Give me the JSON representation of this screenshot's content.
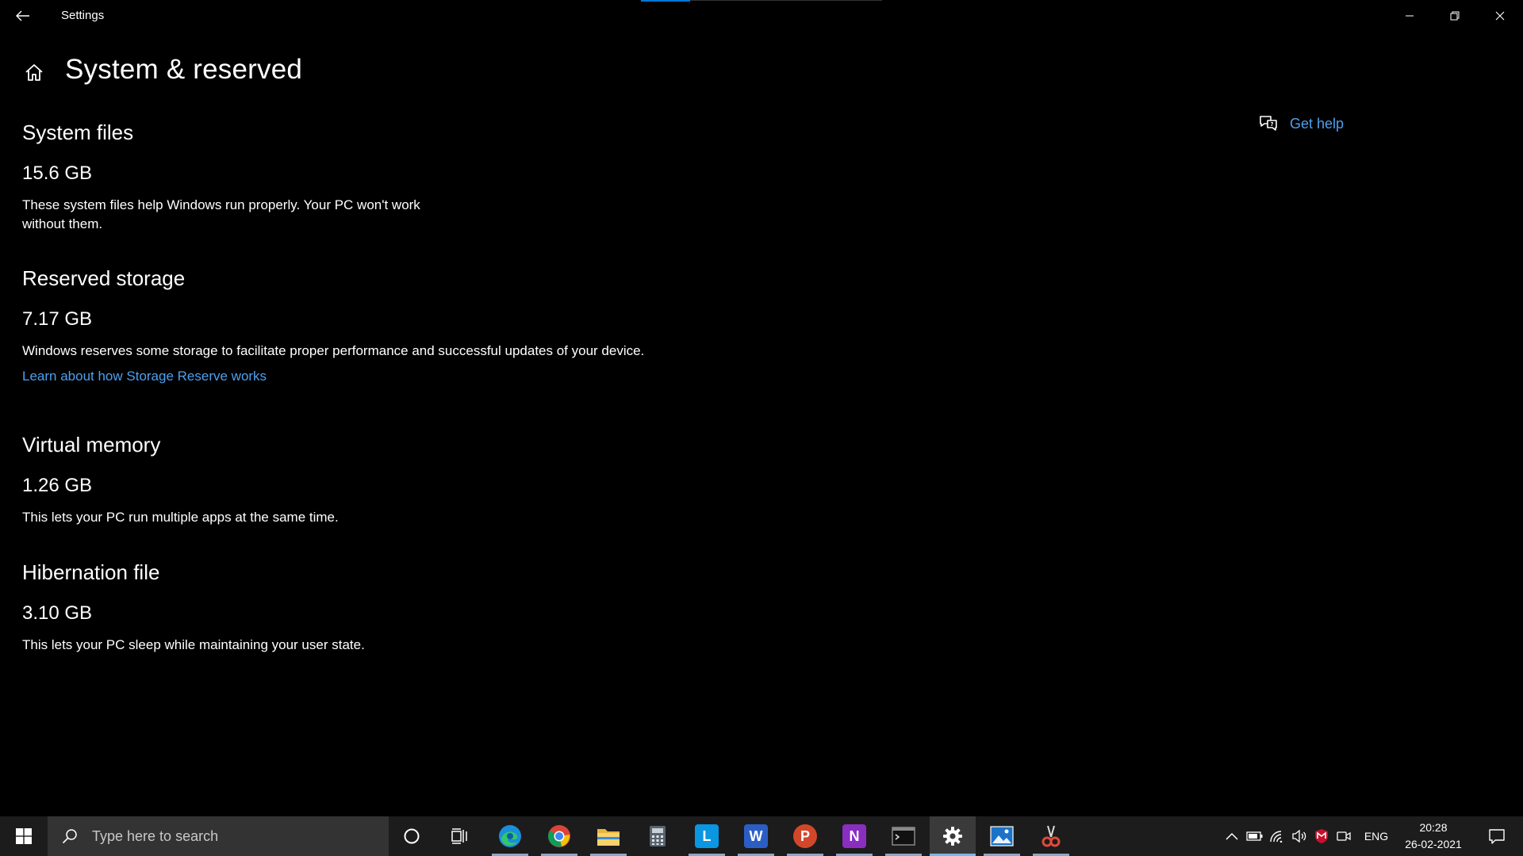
{
  "window": {
    "title": "Settings"
  },
  "page": {
    "title": "System & reserved",
    "help_label": "Get help"
  },
  "sections": [
    {
      "title": "System files",
      "size": "15.6 GB",
      "description": "These system files help Windows run properly. Your PC won't work without them."
    },
    {
      "title": "Reserved storage",
      "size": "7.17 GB",
      "description": "Windows reserves some storage to facilitate proper performance and successful updates of your device.",
      "link": "Learn about how Storage Reserve works"
    },
    {
      "title": "Virtual memory",
      "size": "1.26 GB",
      "description": "This lets your PC run multiple apps at the same time."
    },
    {
      "title": "Hibernation file",
      "size": "3.10 GB",
      "description": "This lets your PC sleep while maintaining your user state."
    }
  ],
  "taskbar": {
    "search_placeholder": "Type here to search",
    "apps": [
      "cortana-circle-icon",
      "task-view-icon",
      "edge-icon",
      "chrome-icon",
      "file-explorer-icon",
      "calculator-icon",
      "l-app-icon",
      "word-icon",
      "powerpoint-icon",
      "onenote-icon",
      "terminal-icon",
      "settings-gear-icon",
      "photos-icon",
      "snipping-tool-icon"
    ],
    "app_letters": {
      "l_app": "L",
      "word": "W",
      "powerpoint": "P",
      "onenote": "N"
    },
    "tray": {
      "language": "ENG",
      "time": "20:28",
      "date": "26-02-2021"
    }
  },
  "colors": {
    "accent": "#0078d7",
    "link": "#4ca0f0",
    "background": "#000000",
    "taskbar": "#1c1c1c"
  }
}
